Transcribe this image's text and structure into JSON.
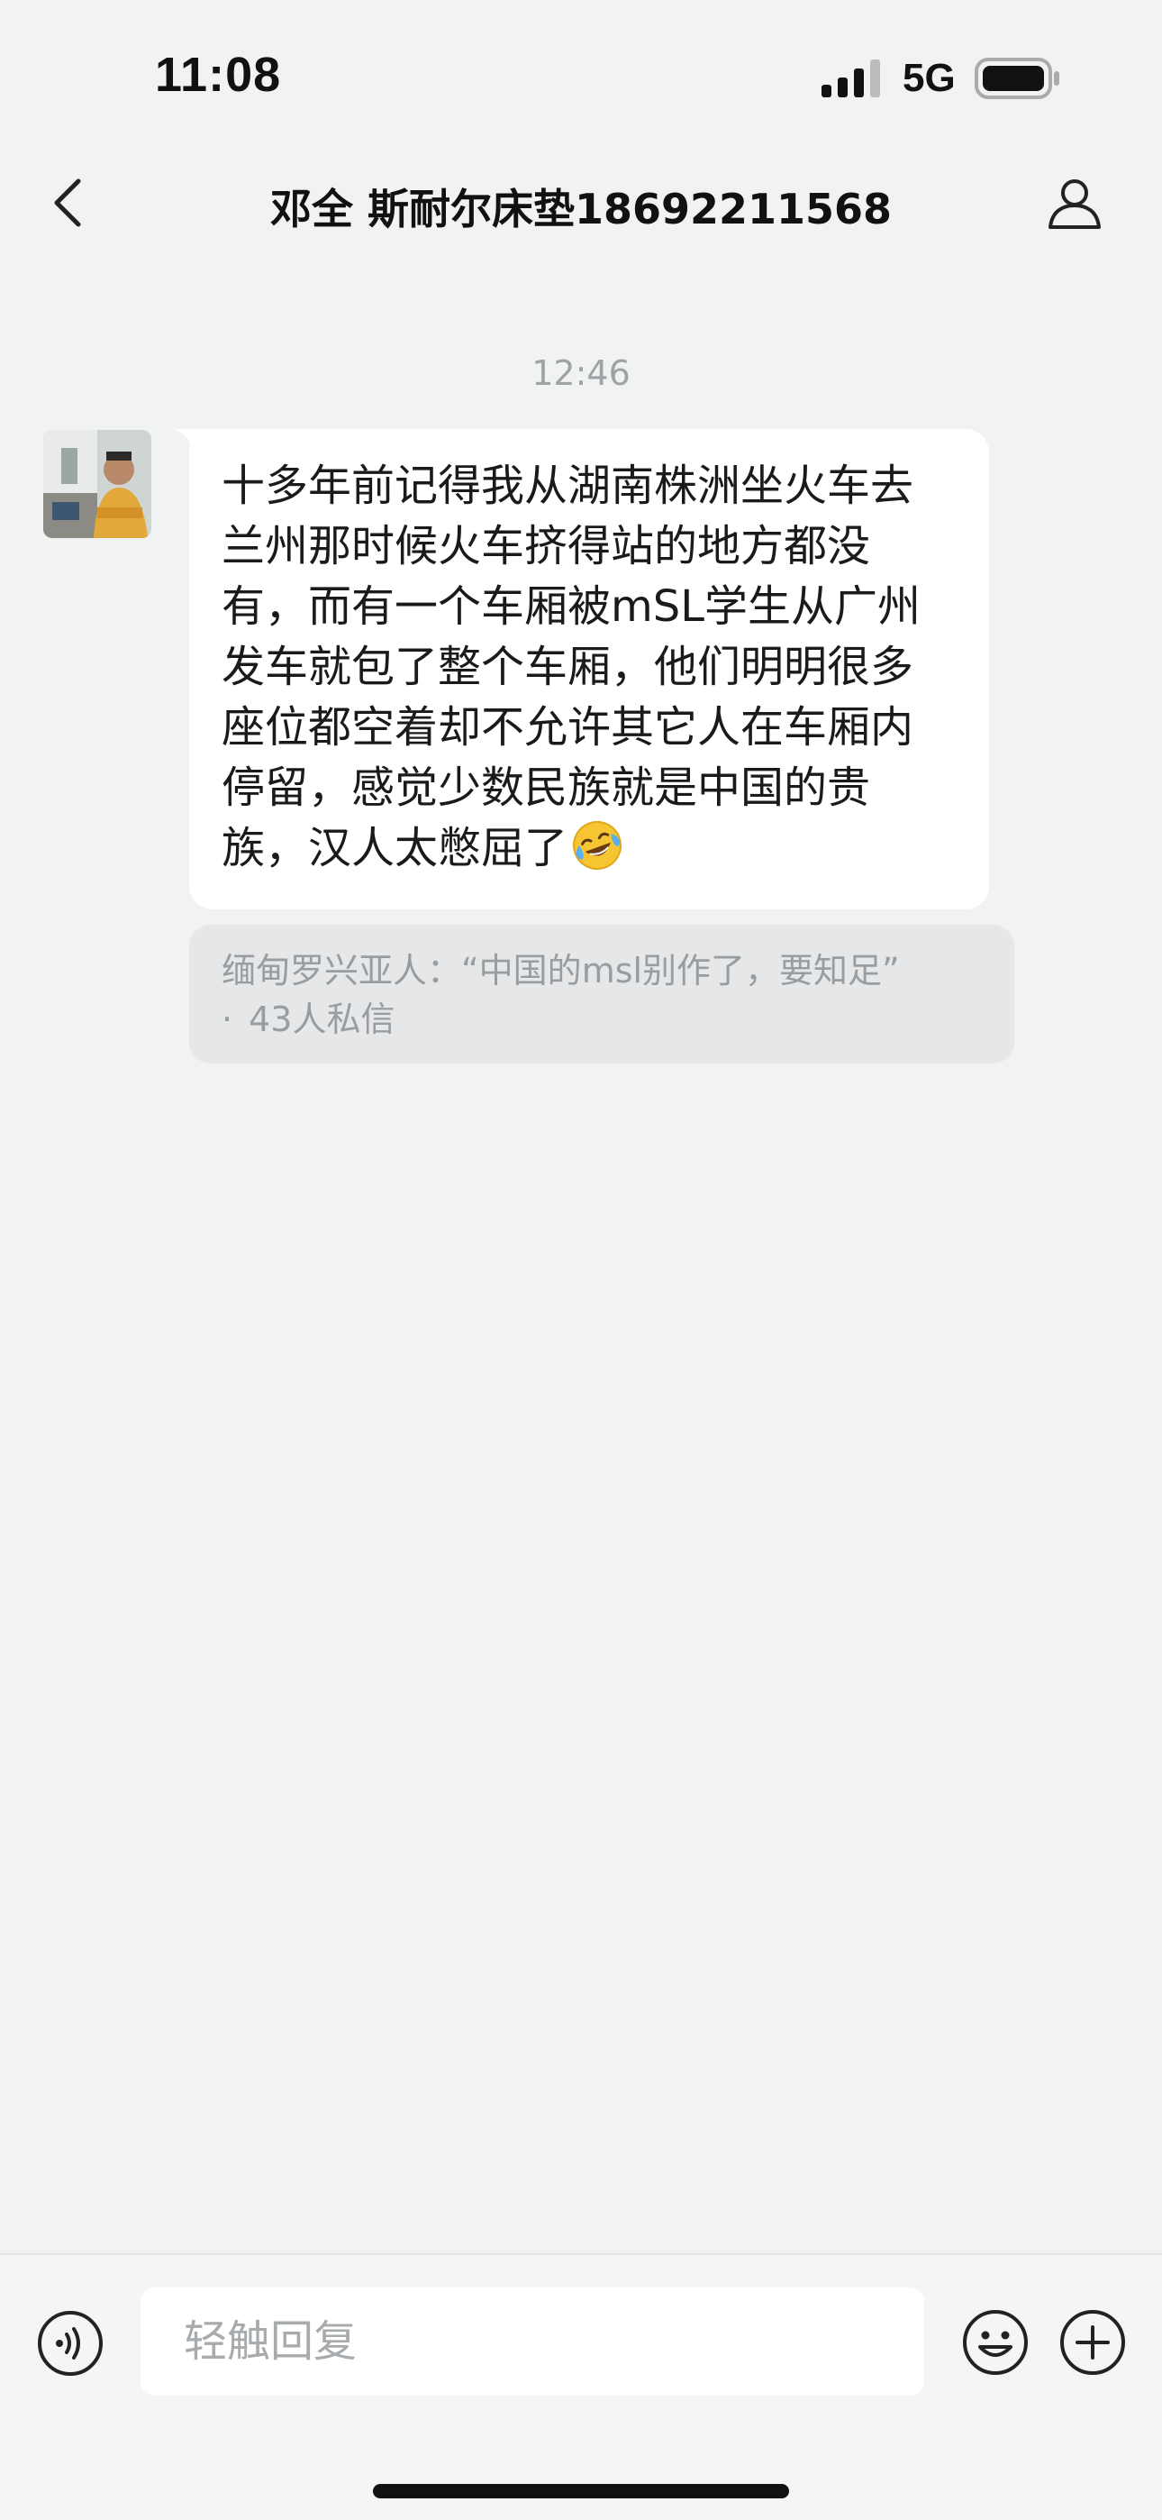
{
  "status_bar": {
    "time": "11:08",
    "network": "5G"
  },
  "nav": {
    "title": "邓全 斯耐尔床垫18692211568"
  },
  "chat": {
    "timestamp": "12:46",
    "message_lines": [
      "十多年前记得我从湖南株洲坐火车去",
      "兰州那时候火车挤得站的地方都没",
      "有，而有一个车厢被mSL学生从广州",
      "发车就包了整个车厢，他们明明很多",
      "座位都空着却不允许其它人在车厢内",
      "停留，感觉少数民族就是中国的贵",
      "族，汉人太憋屈了"
    ],
    "emoji": "rolling-on-floor-laughing",
    "share_card": {
      "title": "缅甸罗兴亚人：“中国的msl别作了，要知足”",
      "meta_dot": "·",
      "meta": "43人私信"
    }
  },
  "input": {
    "placeholder": "轻触回复"
  },
  "colors": {
    "background": "#f1f2f2",
    "bubble": "#ffffff",
    "share_card": "#e6e7e8",
    "muted_text": "#9a9d9f"
  }
}
